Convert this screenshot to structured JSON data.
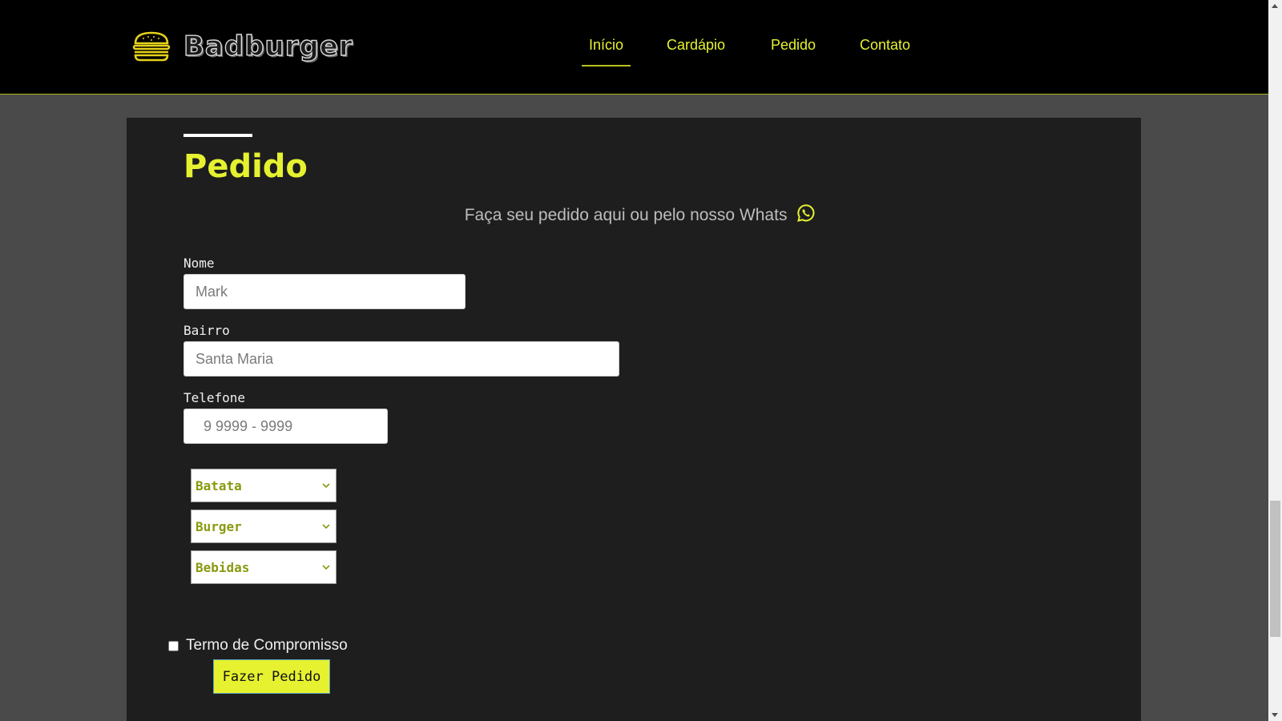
{
  "header": {
    "brand": "Badburger",
    "nav": [
      {
        "label": "Início",
        "active": true
      },
      {
        "label": "Cardápio",
        "active": false
      },
      {
        "label": "Pedido",
        "active": false
      },
      {
        "label": "Contato",
        "active": false
      }
    ]
  },
  "form": {
    "title": "Pedido",
    "subtitle": "Faça seu pedido aqui ou pelo nosso Whats",
    "nome": {
      "label": "Nome",
      "placeholder": "Mark"
    },
    "bairro": {
      "label": "Bairro",
      "placeholder": "Santa Maria"
    },
    "telefone": {
      "label": "Telefone",
      "placeholder": "  9 9999 - 9999"
    },
    "selects": {
      "batata": "Batata",
      "burger": "Burger",
      "bebidas": "Bebidas"
    },
    "terms_label": "Termo de Compromisso",
    "submit_label": "Fazer Pedido"
  },
  "colors": {
    "accent": "#e6f230",
    "header_bg": "#000000",
    "panel_bg": "#1e1e1e",
    "page_bg": "#4a4a4a"
  },
  "icons": {
    "logo": "burger-icon",
    "subtitle": "whatsapp-icon"
  }
}
